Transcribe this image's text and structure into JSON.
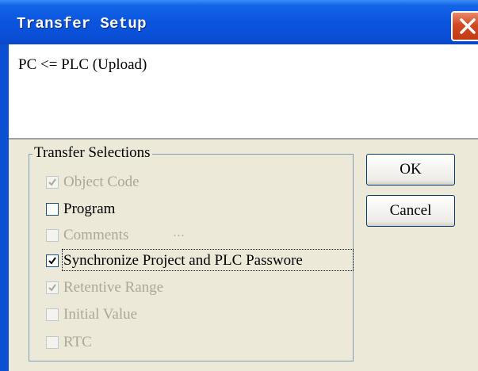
{
  "window": {
    "title": "Transfer Setup"
  },
  "header": {
    "direction_text": "PC <= PLC (Upload)"
  },
  "group": {
    "legend": "Transfer Selections",
    "options": [
      {
        "label": "Object Code",
        "checked": true,
        "enabled": false
      },
      {
        "label": "Program",
        "checked": false,
        "enabled": true
      },
      {
        "label": "Comments",
        "checked": false,
        "enabled": false
      },
      {
        "label": "Synchronize Project and PLC Passwore",
        "checked": true,
        "enabled": true
      },
      {
        "label": "Retentive Range",
        "checked": true,
        "enabled": false
      },
      {
        "label": "Initial Value",
        "checked": false,
        "enabled": false
      },
      {
        "label": "RTC",
        "checked": false,
        "enabled": false
      }
    ],
    "comments_more": "···"
  },
  "buttons": {
    "ok": "OK",
    "cancel": "Cancel"
  }
}
